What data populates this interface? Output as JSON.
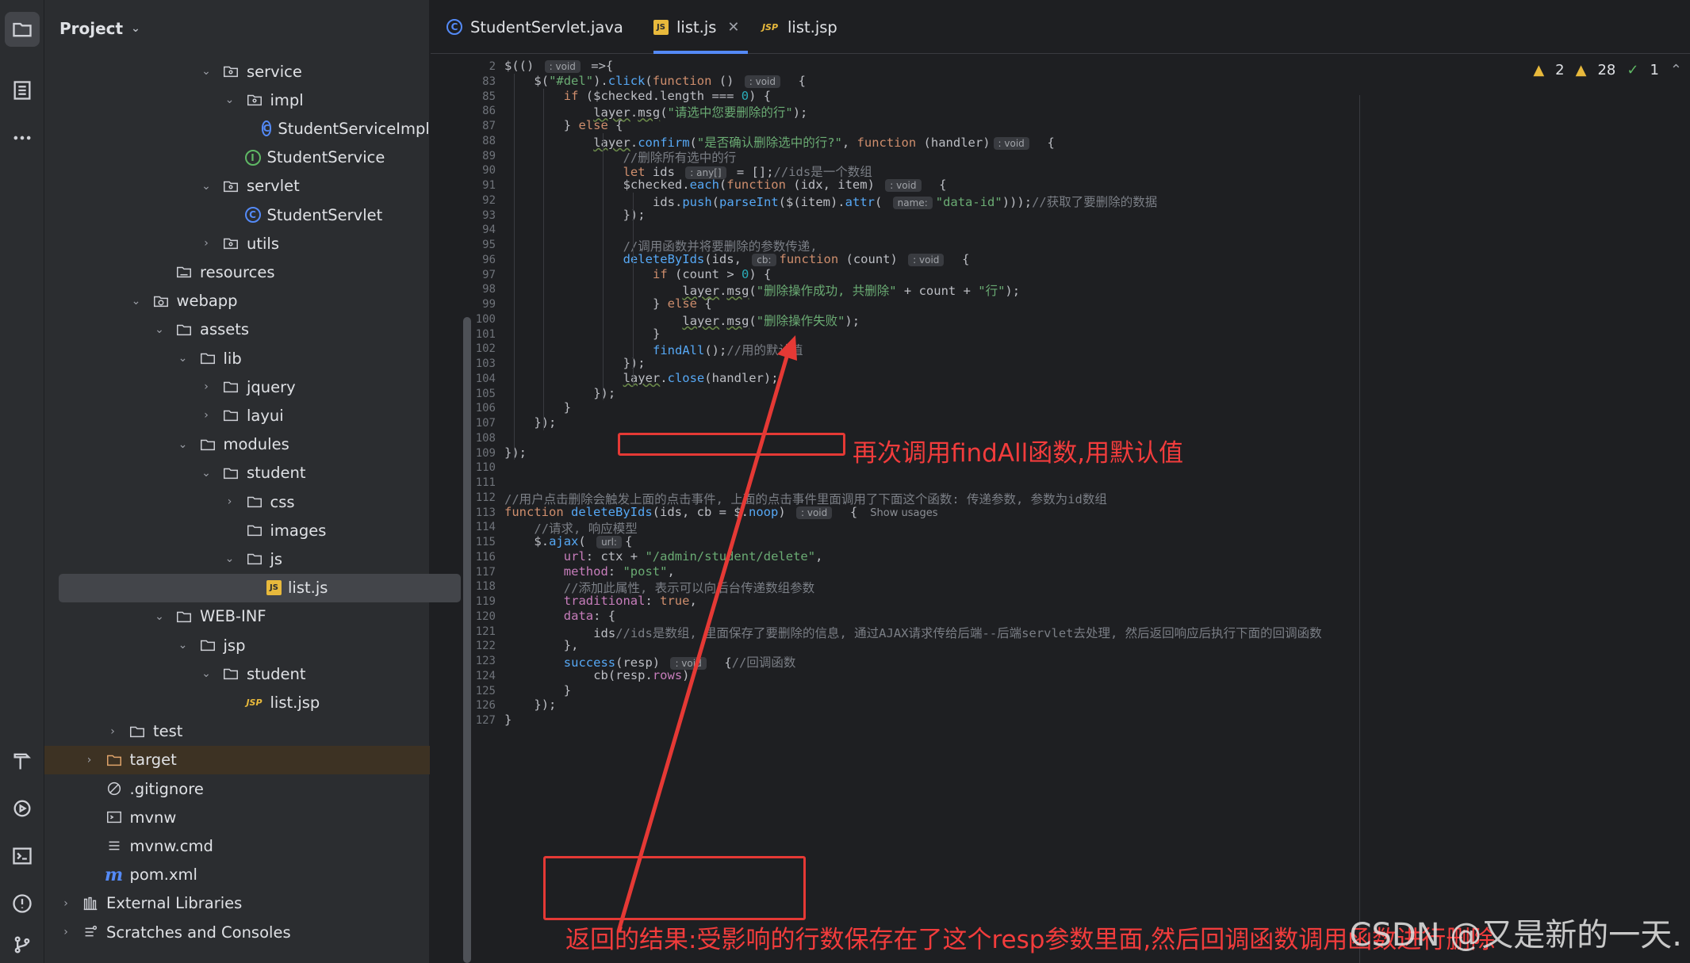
{
  "project": {
    "title": "Project",
    "tree": [
      {
        "label": "service",
        "icon": "folder-pkg",
        "depth": 6,
        "arrow": "down"
      },
      {
        "label": "impl",
        "icon": "folder-pkg",
        "depth": 7,
        "arrow": "down"
      },
      {
        "label": "StudentServiceImpl",
        "icon": "class",
        "depth": 8,
        "arrow": "none"
      },
      {
        "label": "StudentService",
        "icon": "interface",
        "depth": 7,
        "arrow": "none"
      },
      {
        "label": "servlet",
        "icon": "folder-pkg",
        "depth": 6,
        "arrow": "down"
      },
      {
        "label": "StudentServlet",
        "icon": "class",
        "depth": 7,
        "arrow": "none"
      },
      {
        "label": "utils",
        "icon": "folder-pkg",
        "depth": 6,
        "arrow": "right"
      },
      {
        "label": "resources",
        "icon": "folder-res",
        "depth": 4,
        "arrow": "none"
      },
      {
        "label": "webapp",
        "icon": "folder-web",
        "depth": 3,
        "arrow": "down"
      },
      {
        "label": "assets",
        "icon": "folder",
        "depth": 4,
        "arrow": "down"
      },
      {
        "label": "lib",
        "icon": "folder",
        "depth": 5,
        "arrow": "down"
      },
      {
        "label": "jquery",
        "icon": "folder",
        "depth": 6,
        "arrow": "right"
      },
      {
        "label": "layui",
        "icon": "folder",
        "depth": 6,
        "arrow": "right"
      },
      {
        "label": "modules",
        "icon": "folder",
        "depth": 5,
        "arrow": "down"
      },
      {
        "label": "student",
        "icon": "folder",
        "depth": 6,
        "arrow": "down"
      },
      {
        "label": "css",
        "icon": "folder",
        "depth": 7,
        "arrow": "right"
      },
      {
        "label": "images",
        "icon": "folder",
        "depth": 7,
        "arrow": "none"
      },
      {
        "label": "js",
        "icon": "folder",
        "depth": 7,
        "arrow": "down"
      },
      {
        "label": "list.js",
        "icon": "js",
        "depth": 8,
        "arrow": "none",
        "selected": true
      },
      {
        "label": "WEB-INF",
        "icon": "folder",
        "depth": 4,
        "arrow": "down"
      },
      {
        "label": "jsp",
        "icon": "folder",
        "depth": 5,
        "arrow": "down"
      },
      {
        "label": "student",
        "icon": "folder",
        "depth": 6,
        "arrow": "down"
      },
      {
        "label": "list.jsp",
        "icon": "jsp",
        "depth": 7,
        "arrow": "none"
      },
      {
        "label": "test",
        "icon": "folder",
        "depth": 2,
        "arrow": "right"
      },
      {
        "label": "target",
        "icon": "folder-orange",
        "depth": 1,
        "arrow": "right",
        "highlight": true
      },
      {
        "label": ".gitignore",
        "icon": "ignore",
        "depth": 1,
        "arrow": "none"
      },
      {
        "label": "mvnw",
        "icon": "terminal",
        "depth": 1,
        "arrow": "none"
      },
      {
        "label": "mvnw.cmd",
        "icon": "lines",
        "depth": 1,
        "arrow": "none"
      },
      {
        "label": "pom.xml",
        "icon": "maven",
        "depth": 1,
        "arrow": "none"
      },
      {
        "label": "External Libraries",
        "icon": "libs",
        "depth": 0,
        "arrow": "right"
      },
      {
        "label": "Scratches and Consoles",
        "icon": "scratch",
        "depth": 0,
        "arrow": "right"
      }
    ]
  },
  "tabs": [
    {
      "label": "StudentServlet.java",
      "icon": "class",
      "active": false
    },
    {
      "label": "list.js",
      "icon": "js",
      "active": true
    },
    {
      "label": "list.jsp",
      "icon": "jsp",
      "active": false
    }
  ],
  "inspections": {
    "warn1": "2",
    "warn2": "28",
    "ok": "1"
  },
  "lines": [
    {
      "n": "2",
      "i": 0,
      "t": [
        [
          "pn",
          "$(() "
        ],
        [
          "hint",
          ": void"
        ],
        [
          "pn",
          " =>{"
        ]
      ]
    },
    {
      "n": "83",
      "i": 1,
      "t": [
        [
          "pn",
          "$("
        ],
        [
          "str",
          "\"#del\""
        ],
        [
          "pn",
          ")."
        ],
        [
          "fn",
          "click"
        ],
        [
          "pn",
          "("
        ],
        [
          "kw",
          "function"
        ],
        [
          "pn",
          " () "
        ],
        [
          "hint",
          ": void"
        ],
        [
          "pn",
          "  {"
        ]
      ]
    },
    {
      "n": "85",
      "i": 2,
      "t": [
        [
          "kw",
          "if"
        ],
        [
          "pn",
          " ($checked.length === "
        ],
        [
          "num",
          "0"
        ],
        [
          "pn",
          ") {"
        ]
      ]
    },
    {
      "n": "86",
      "i": 3,
      "t": [
        [
          "uline",
          "layer"
        ],
        [
          "pn",
          "."
        ],
        [
          "uline",
          "msg"
        ],
        [
          "pn",
          "("
        ],
        [
          "str",
          "\"请选中您要删除的行\""
        ],
        [
          "pn",
          ");"
        ]
      ]
    },
    {
      "n": "87",
      "i": 2,
      "t": [
        [
          "pn",
          "} "
        ],
        [
          "kw",
          "else"
        ],
        [
          "pn",
          " {"
        ]
      ]
    },
    {
      "n": "88",
      "i": 3,
      "t": [
        [
          "uline",
          "layer"
        ],
        [
          "pn",
          "."
        ],
        [
          "fn",
          "confirm"
        ],
        [
          "pn",
          "("
        ],
        [
          "str",
          "\"是否确认删除选中的行?\""
        ],
        [
          "pn",
          ", "
        ],
        [
          "kw",
          "function"
        ],
        [
          "pn",
          " (handler)"
        ],
        [
          "hint",
          ": void"
        ],
        [
          "pn",
          "  {"
        ]
      ]
    },
    {
      "n": "89",
      "i": 4,
      "t": [
        [
          "cmt",
          "//删除所有选中的行"
        ]
      ]
    },
    {
      "n": "90",
      "i": 4,
      "t": [
        [
          "kw",
          "let"
        ],
        [
          "pn",
          " ids "
        ],
        [
          "hint",
          ": any[]"
        ],
        [
          "pn",
          " = [];"
        ],
        [
          "cmt",
          "//ids是一个数组"
        ]
      ]
    },
    {
      "n": "91",
      "i": 4,
      "t": [
        [
          "pn",
          "$checked."
        ],
        [
          "fn",
          "each"
        ],
        [
          "pn",
          "("
        ],
        [
          "kw",
          "function"
        ],
        [
          "pn",
          " (idx, item) "
        ],
        [
          "hint",
          ": void"
        ],
        [
          "pn",
          "  {"
        ]
      ]
    },
    {
      "n": "92",
      "i": 5,
      "t": [
        [
          "pn",
          "ids."
        ],
        [
          "fn",
          "push"
        ],
        [
          "pn",
          "("
        ],
        [
          "fn",
          "parseInt"
        ],
        [
          "pn",
          "($(item)."
        ],
        [
          "fn",
          "attr"
        ],
        [
          "pn",
          "( "
        ],
        [
          "hint",
          "name:"
        ],
        [
          "str",
          "\"data-id\""
        ],
        [
          "pn",
          ")));"
        ],
        [
          "cmt",
          "//获取了要删除的数据"
        ]
      ]
    },
    {
      "n": "93",
      "i": 4,
      "t": [
        [
          "pn",
          "});"
        ]
      ]
    },
    {
      "n": "94",
      "i": 0,
      "t": []
    },
    {
      "n": "95",
      "i": 4,
      "t": [
        [
          "cmt",
          "//调用函数并将要删除的参数传递,"
        ]
      ]
    },
    {
      "n": "96",
      "i": 4,
      "t": [
        [
          "fn",
          "deleteByIds"
        ],
        [
          "pn",
          "(ids, "
        ],
        [
          "hint",
          "cb:"
        ],
        [
          "kw",
          "function"
        ],
        [
          "pn",
          " (count) "
        ],
        [
          "hint",
          ": void"
        ],
        [
          "pn",
          "  {"
        ]
      ]
    },
    {
      "n": "97",
      "i": 5,
      "t": [
        [
          "kw",
          "if"
        ],
        [
          "pn",
          " (count > "
        ],
        [
          "num",
          "0"
        ],
        [
          "pn",
          ") {"
        ]
      ]
    },
    {
      "n": "98",
      "i": 6,
      "t": [
        [
          "uline",
          "layer"
        ],
        [
          "pn",
          "."
        ],
        [
          "uline",
          "msg"
        ],
        [
          "pn",
          "("
        ],
        [
          "str",
          "\"删除操作成功, 共删除\""
        ],
        [
          "pn",
          " + count + "
        ],
        [
          "str",
          "\"行\""
        ],
        [
          "pn",
          ");"
        ]
      ]
    },
    {
      "n": "99",
      "i": 5,
      "t": [
        [
          "pn",
          "} "
        ],
        [
          "kw",
          "else"
        ],
        [
          "pn",
          " {"
        ]
      ]
    },
    {
      "n": "100",
      "i": 6,
      "t": [
        [
          "uline",
          "layer"
        ],
        [
          "pn",
          "."
        ],
        [
          "uline",
          "msg"
        ],
        [
          "pn",
          "("
        ],
        [
          "str",
          "\"删除操作失败\""
        ],
        [
          "pn",
          ");"
        ]
      ]
    },
    {
      "n": "101",
      "i": 5,
      "t": [
        [
          "pn",
          "}"
        ]
      ]
    },
    {
      "n": "102",
      "i": 5,
      "t": [
        [
          "fn",
          "findAll"
        ],
        [
          "pn",
          "();"
        ],
        [
          "cmt",
          "//用的默认值"
        ]
      ]
    },
    {
      "n": "103",
      "i": 4,
      "t": [
        [
          "pn",
          "});"
        ]
      ]
    },
    {
      "n": "104",
      "i": 4,
      "t": [
        [
          "uline",
          "layer"
        ],
        [
          "pn",
          "."
        ],
        [
          "fn",
          "close"
        ],
        [
          "pn",
          "(handler);"
        ]
      ]
    },
    {
      "n": "105",
      "i": 3,
      "t": [
        [
          "pn",
          "});"
        ]
      ]
    },
    {
      "n": "106",
      "i": 2,
      "t": [
        [
          "pn",
          "}"
        ]
      ]
    },
    {
      "n": "107",
      "i": 1,
      "t": [
        [
          "pn",
          "});"
        ]
      ]
    },
    {
      "n": "108",
      "i": 0,
      "t": []
    },
    {
      "n": "109",
      "i": 0,
      "t": [
        [
          "pn",
          "});"
        ]
      ]
    },
    {
      "n": "110",
      "i": 0,
      "t": []
    },
    {
      "n": "111",
      "i": 0,
      "t": []
    },
    {
      "n": "112",
      "i": 0,
      "t": [
        [
          "cmt",
          "//用户点击删除会触发上面的点击事件, 上面的点击事件里面调用了下面这个函数: 传递参数, 参数为id数组"
        ]
      ]
    },
    {
      "n": "113",
      "i": 0,
      "t": [
        [
          "kw",
          "function"
        ],
        [
          "pn",
          " "
        ],
        [
          "fn",
          "deleteByIds"
        ],
        [
          "pn",
          "(ids, cb = $."
        ],
        [
          "fn",
          "noop"
        ],
        [
          "pn",
          ") "
        ],
        [
          "hint",
          ": void"
        ],
        [
          "pn",
          "  {"
        ],
        [
          "usage",
          "Show usages"
        ]
      ]
    },
    {
      "n": "114",
      "i": 1,
      "t": [
        [
          "cmt",
          "//请求, 响应模型"
        ]
      ]
    },
    {
      "n": "115",
      "i": 1,
      "t": [
        [
          "pn",
          "$."
        ],
        [
          "fn",
          "ajax"
        ],
        [
          "pn",
          "( "
        ],
        [
          "hint",
          "url:"
        ],
        [
          "pn",
          "{"
        ]
      ]
    },
    {
      "n": "116",
      "i": 2,
      "t": [
        [
          "prop",
          "url"
        ],
        [
          "pn",
          ": ctx + "
        ],
        [
          "str",
          "\"/admin/student/delete\""
        ],
        [
          "pn",
          ","
        ]
      ]
    },
    {
      "n": "117",
      "i": 2,
      "t": [
        [
          "prop",
          "method"
        ],
        [
          "pn",
          ": "
        ],
        [
          "str",
          "\"post\""
        ],
        [
          "pn",
          ","
        ]
      ]
    },
    {
      "n": "118",
      "i": 2,
      "t": [
        [
          "cmt",
          "//添加此属性, 表示可以向后台传递数组参数"
        ]
      ]
    },
    {
      "n": "119",
      "i": 2,
      "t": [
        [
          "prop",
          "traditional"
        ],
        [
          "pn",
          ": "
        ],
        [
          "kw",
          "true"
        ],
        [
          "pn",
          ","
        ]
      ]
    },
    {
      "n": "120",
      "i": 2,
      "t": [
        [
          "prop",
          "data"
        ],
        [
          "pn",
          ": {"
        ]
      ]
    },
    {
      "n": "121",
      "i": 3,
      "t": [
        [
          "pn",
          "ids"
        ],
        [
          "cmt",
          "//ids是数组, 里面保存了要删除的信息, 通过AJAX请求传给后端--后端servlet去处理, 然后返回响应后执行下面的回调函数"
        ]
      ]
    },
    {
      "n": "122",
      "i": 2,
      "t": [
        [
          "pn",
          "},"
        ]
      ]
    },
    {
      "n": "123",
      "i": 2,
      "t": [
        [
          "fn",
          "success"
        ],
        [
          "pn",
          "(resp) "
        ],
        [
          "hint",
          ": void"
        ],
        [
          "pn",
          "  {"
        ],
        [
          "cmt",
          "//回调函数"
        ]
      ]
    },
    {
      "n": "124",
      "i": 3,
      "t": [
        [
          "pn",
          "cb(resp."
        ],
        [
          "prop",
          "rows"
        ],
        [
          "pn",
          ");"
        ]
      ]
    },
    {
      "n": "125",
      "i": 2,
      "t": [
        [
          "pn",
          "}"
        ]
      ]
    },
    {
      "n": "126",
      "i": 1,
      "t": [
        [
          "pn",
          "});"
        ]
      ]
    },
    {
      "n": "127",
      "i": 0,
      "t": [
        [
          "pn",
          "}"
        ]
      ]
    }
  ],
  "annotations": {
    "findall_note": "再次调用findAll函数,用默认值",
    "resp_note": "返回的结果:受影响的行数保存在了这个resp参数里面,然后回调函数调用函数进行删除"
  },
  "watermark": "CSDN @又是新的一天."
}
